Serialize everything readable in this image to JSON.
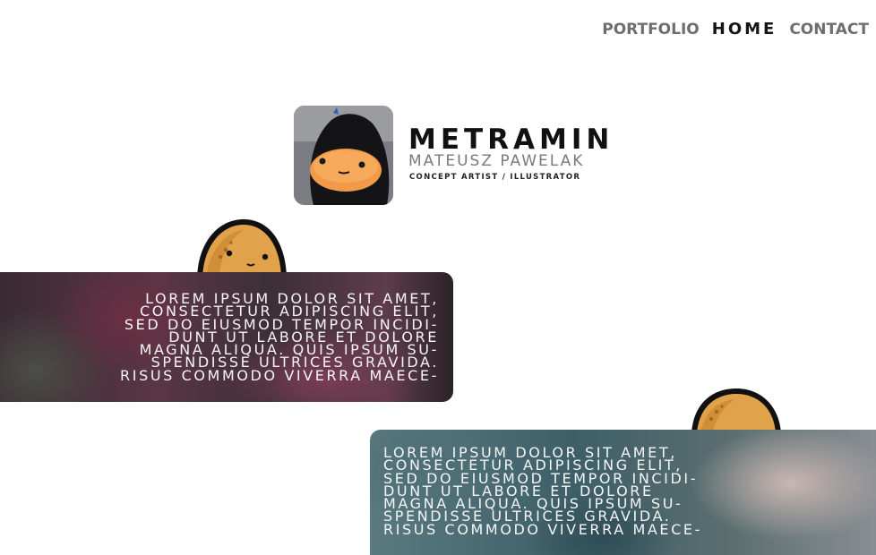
{
  "nav": {
    "items": [
      {
        "label": "PORTFOLIO",
        "active": false
      },
      {
        "label": "HOME",
        "active": true
      },
      {
        "label": "CONTACT",
        "active": false
      }
    ]
  },
  "brand": {
    "title": "METRAMIN",
    "subtitle": "MATEUSZ PAWELAK",
    "role": "CONCEPT ARTIST / ILLUSTRATOR"
  },
  "cards": [
    {
      "lines": [
        "LOREM IPSUM DOLOR SIT AMET,",
        "CONSECTETUR ADIPISCING ELIT,",
        "SED DO EIUSMOD TEMPOR INCIDI-",
        "DUNT UT LABORE ET DOLORE",
        "MAGNA ALIQUA. QUIS IPSUM SU-",
        "SPENDISSE ULTRICES GRAVIDA.",
        "RISUS COMMODO VIVERRA MAECE-"
      ]
    },
    {
      "lines": [
        "LOREM IPSUM DOLOR SIT AMET,",
        "CONSECTETUR ADIPISCING ELIT,",
        "SED DO EIUSMOD TEMPOR INCIDI-",
        "DUNT UT LABORE ET DOLORE",
        "MAGNA ALIQUA. QUIS IPSUM SU-",
        "SPENDISSE ULTRICES GRAVIDA.",
        "RISUS COMMODO VIVERRA MAECE-"
      ]
    }
  ],
  "icons": {
    "mascot": "potato-mascot-icon"
  },
  "colors": {
    "nav_active": "#141414",
    "nav_inactive": "#6e6e6e",
    "card_text": "#f5f5f5"
  }
}
